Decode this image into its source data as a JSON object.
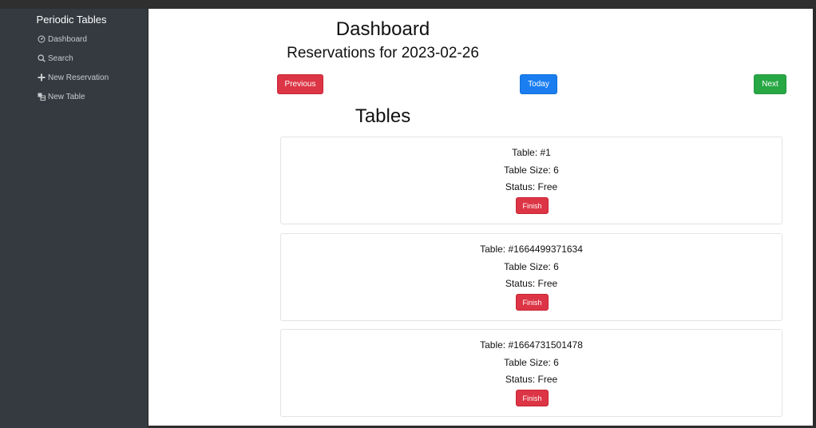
{
  "sidebar": {
    "brand": "Periodic Tables",
    "items": [
      {
        "label": "Dashboard",
        "icon": "dashboard-icon"
      },
      {
        "label": "Search",
        "icon": "search-icon"
      },
      {
        "label": "New Reservation",
        "icon": "plus-icon"
      },
      {
        "label": "New Table",
        "icon": "table-icon"
      }
    ]
  },
  "header": {
    "title": "Dashboard",
    "subtitle": "Reservations for 2023-02-26"
  },
  "date_nav": {
    "previous_label": "Previous",
    "today_label": "Today",
    "next_label": "Next"
  },
  "tables_section": {
    "title": "Tables",
    "cards": [
      {
        "table": "Table: #1",
        "size": "Table Size: 6",
        "status": "Status: Free",
        "action": "Finish"
      },
      {
        "table": "Table: #1664499371634",
        "size": "Table Size: 6",
        "status": "Status: Free",
        "action": "Finish"
      },
      {
        "table": "Table: #1664731501478",
        "size": "Table Size: 6",
        "status": "Status: Free",
        "action": "Finish"
      }
    ]
  },
  "colors": {
    "sidebar_bg": "#343a40",
    "danger": "#dc3545",
    "primary": "#1a7ef0",
    "success": "#28a745"
  }
}
